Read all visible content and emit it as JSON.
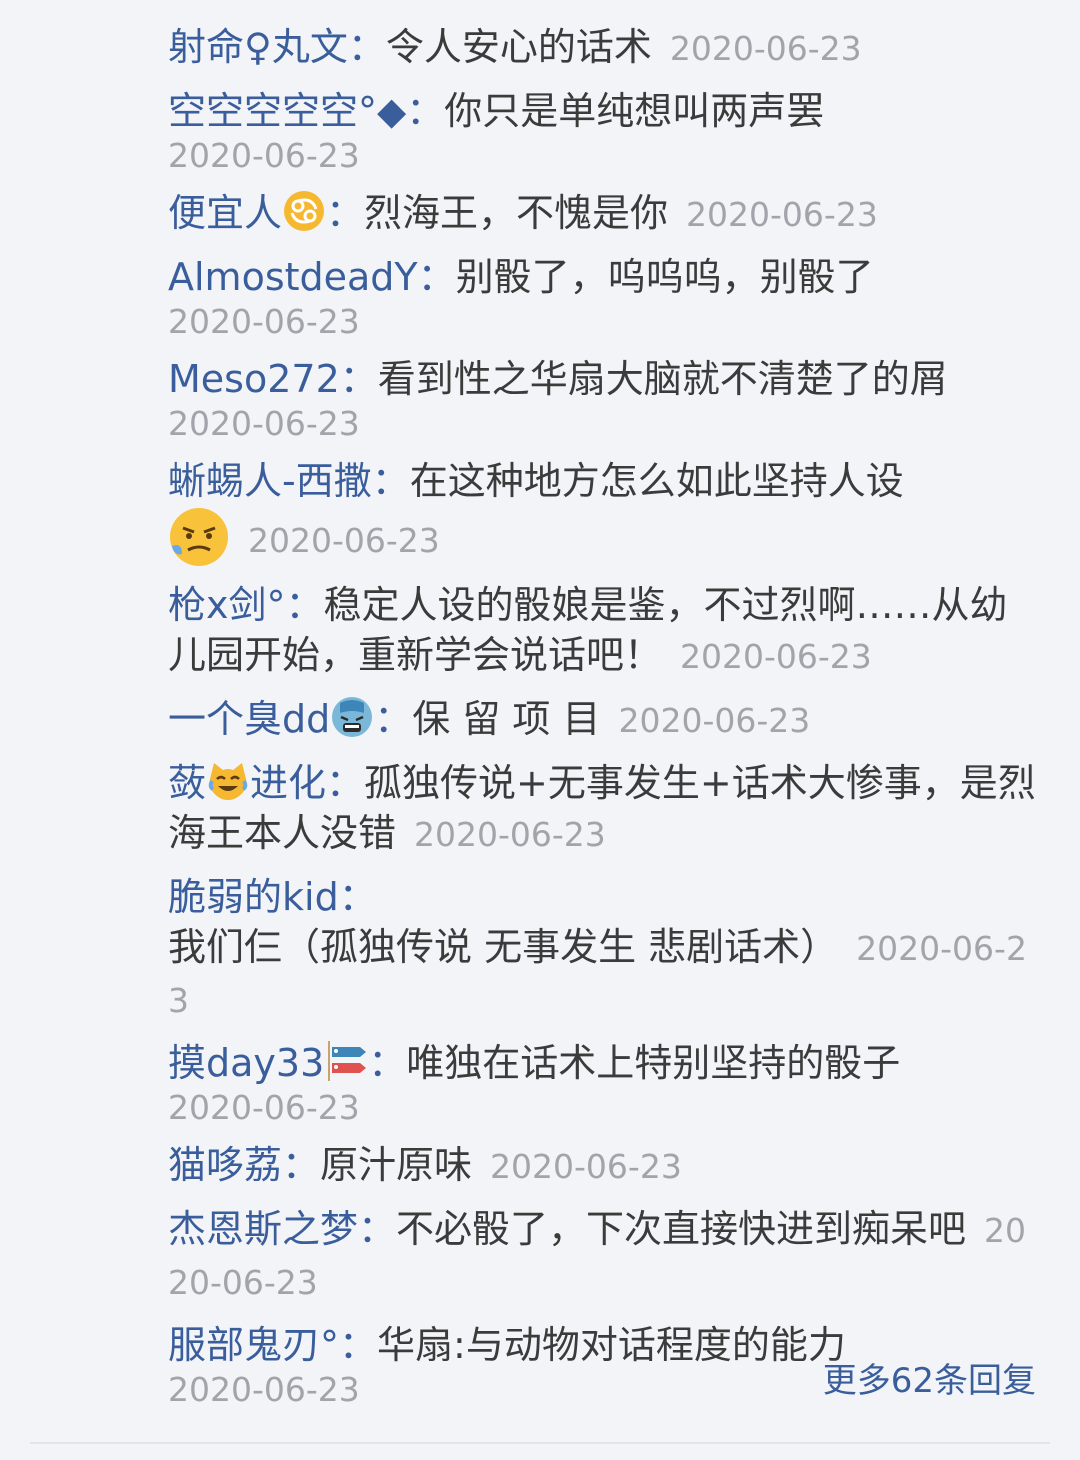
{
  "replies": [
    {
      "user": "射命♀丸文",
      "sep": "：",
      "text": "令人安心的话术",
      "date": "2020-06-23"
    },
    {
      "user": "空空空空空°◆",
      "sep": "：",
      "text": "你只是单纯想叫两声罢",
      "date": "2020-06-23"
    },
    {
      "user": "便宜人",
      "sep": "：",
      "text": "烈海王，不愧是你",
      "date": "2020-06-23"
    },
    {
      "user": "AlmostdeadY",
      "sep": "：",
      "text": "别骰了，呜呜呜，别骰了",
      "date": "2020-06-23"
    },
    {
      "user": "Meso272",
      "sep": "：",
      "text": "看到性之华扇大脑就不清楚了的屑",
      "date": "2020-06-23"
    },
    {
      "user": "蜥蜴人-西撒",
      "sep": "：",
      "text": "在这种地方怎么如此坚持人设",
      "date": "2020-06-23"
    },
    {
      "user": "枪x剑°",
      "sep": "：",
      "text": "稳定人设的骰娘是鉴，不过烈啊……从幼儿园开始，重新学会说话吧！",
      "date": "2020-06-23"
    },
    {
      "user": "一个臭dd",
      "sep": "：",
      "text": "保 留 项 目",
      "date": "2020-06-23"
    },
    {
      "user_a": "蔹",
      "user_b": "进化",
      "sep": "：",
      "text": "孤独传说+无事发生+话术大惨事，是烈海王本人没错",
      "date": "2020-06-23"
    },
    {
      "user": "脆弱的kid",
      "sep": "：",
      "text": "我们仨（孤独传说 无事发生 悲剧话术）",
      "date": "2020-06-23"
    },
    {
      "user": "摸day33",
      "sep": "：",
      "text": "唯独在话术上特别坚持的骰子",
      "date": "2020-06-23"
    },
    {
      "user": "猫哆荔",
      "sep": "：",
      "text": "原汁原味",
      "date": "2020-06-23"
    },
    {
      "user": "杰恩斯之梦",
      "sep": "：",
      "text": "不必骰了，下次直接快进到痴呆吧",
      "date": "2020-06-23"
    },
    {
      "user": "服部鬼刃°",
      "sep": "：",
      "text": "华扇:与动物对话程度的能力",
      "date": "2020-06-23"
    }
  ],
  "more_link": "更多62条回复",
  "icons": {
    "cancer": "cancer-zodiac-icon",
    "angry": "angry-steam-face-icon",
    "cold_sweat": "anxious-sweat-face-icon",
    "cat_joy": "cat-tears-of-joy-icon",
    "carp": "carp-streamer-icon"
  },
  "colors": {
    "username": "#3a5e9c",
    "text": "#3b3b3b",
    "date": "#a1a4aa",
    "background": "#f3f4f7"
  }
}
